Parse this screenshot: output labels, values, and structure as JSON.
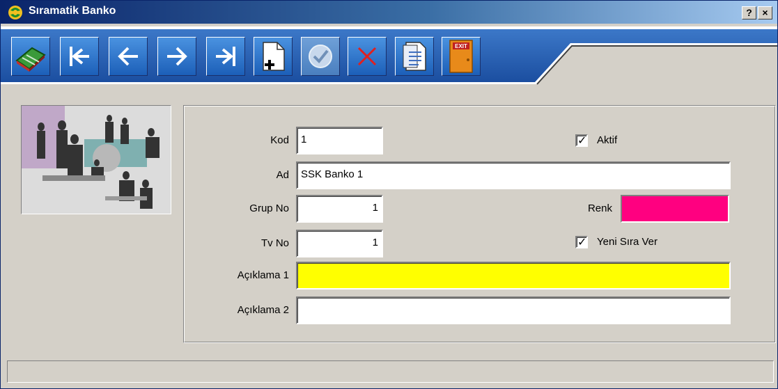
{
  "window": {
    "title": "Sıramatik Banko",
    "help_label": "?",
    "close_label": "×"
  },
  "toolbar": {
    "buttons": [
      {
        "name": "cash-register",
        "icon": "cash-register-icon"
      },
      {
        "name": "first",
        "icon": "first-record-icon"
      },
      {
        "name": "previous",
        "icon": "previous-record-icon"
      },
      {
        "name": "next",
        "icon": "next-record-icon"
      },
      {
        "name": "last",
        "icon": "last-record-icon"
      },
      {
        "name": "new",
        "icon": "new-document-icon"
      },
      {
        "name": "save",
        "icon": "checkmark-icon"
      },
      {
        "name": "delete",
        "icon": "delete-x-icon"
      },
      {
        "name": "report",
        "icon": "report-document-icon"
      },
      {
        "name": "exit",
        "icon": "exit-door-icon",
        "label": "EXIT"
      }
    ]
  },
  "form": {
    "kod": {
      "label": "Kod",
      "value": "1"
    },
    "ad": {
      "label": "Ad",
      "value": "SSK Banko 1"
    },
    "grup_no": {
      "label": "Grup No",
      "value": "1"
    },
    "tv_no": {
      "label": "Tv No",
      "value": "1"
    },
    "aciklama1": {
      "label": "Açıklama 1",
      "value": ""
    },
    "aciklama2": {
      "label": "Açıklama 2",
      "value": ""
    },
    "aktif": {
      "label": "Aktif",
      "checked": true
    },
    "renk": {
      "label": "Renk",
      "color": "#ff0080"
    },
    "yeni_sira_ver": {
      "label": "Yeni Sıra Ver",
      "checked": true
    }
  },
  "colors": {
    "aciklama1_bg": "#ffff00",
    "toolbar_blue": "#1c5fb8"
  }
}
